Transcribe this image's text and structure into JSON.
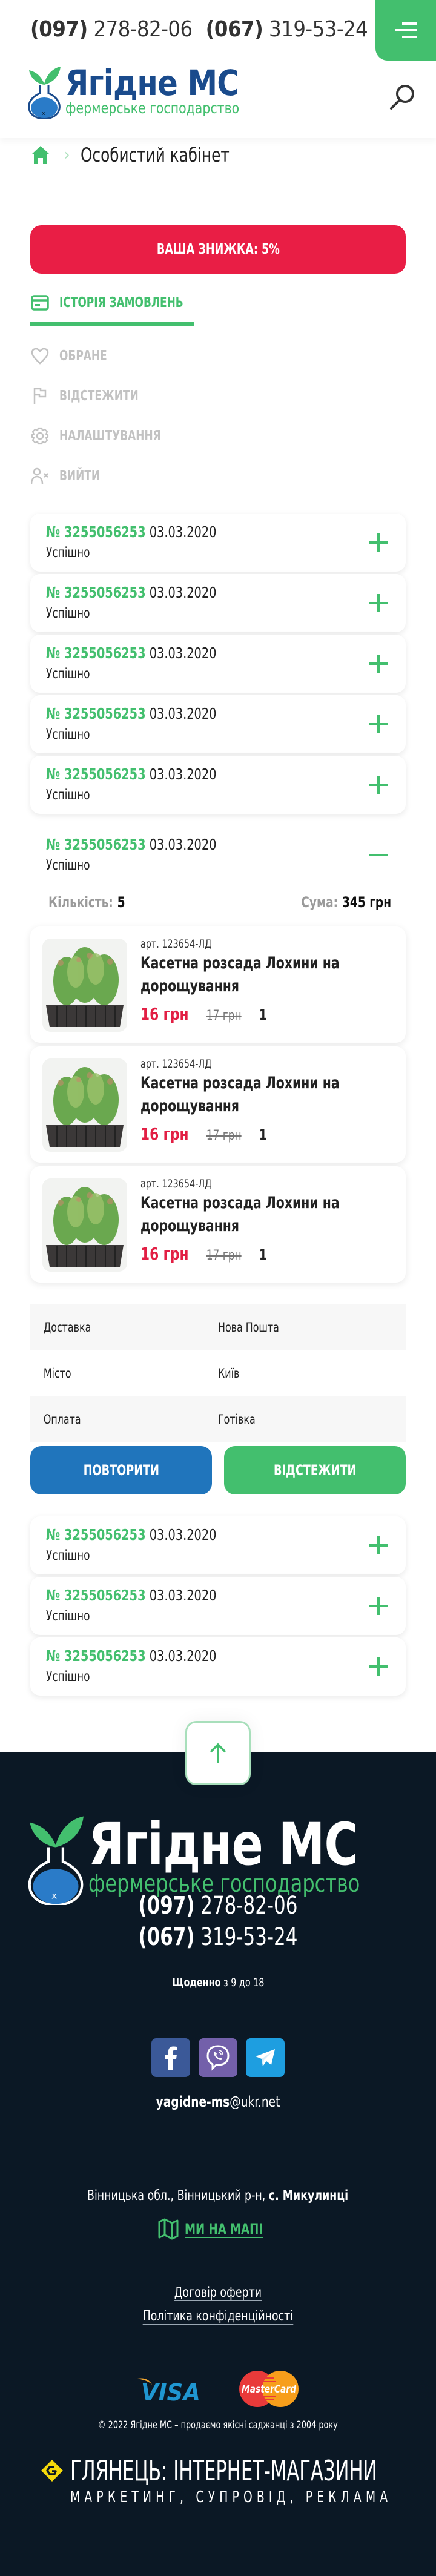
{
  "header": {
    "phones": [
      {
        "code": "(097)",
        "number": "278-82-06"
      },
      {
        "code": "(067)",
        "number": "319-53-24"
      }
    ],
    "menu_icon": "menu-icon",
    "search_icon": "search-icon",
    "logo": {
      "title": "Ягідне МС",
      "subtitle": "фермерське господарство"
    }
  },
  "breadcrumb": {
    "home_icon": "home-icon",
    "current": "Особистий кабінет"
  },
  "discount": {
    "label": "ВАША ЗНИЖКА: 5%"
  },
  "account_nav": {
    "active": {
      "label": "ІСТОРІЯ ЗАМОВЛЕНЬ",
      "icon": "card-icon"
    },
    "items": [
      {
        "label": "ОБРАНЕ",
        "icon": "heart-icon"
      },
      {
        "label": "ВІДСТЕЖИТИ",
        "icon": "flag-icon"
      },
      {
        "label": "НАЛАШТУВАННЯ",
        "icon": "gear-icon"
      },
      {
        "label": "ВИЙТИ",
        "icon": "user-remove-icon"
      }
    ]
  },
  "orders_before": [
    {
      "number": "№ 3255056253",
      "date": "03.03.2020",
      "status": "Успішно"
    },
    {
      "number": "№ 3255056253",
      "date": "03.03.2020",
      "status": "Успішно"
    },
    {
      "number": "№ 3255056253",
      "date": "03.03.2020",
      "status": "Успішно"
    },
    {
      "number": "№ 3255056253",
      "date": "03.03.2020",
      "status": "Успішно"
    },
    {
      "number": "№ 3255056253",
      "date": "03.03.2020",
      "status": "Успішно"
    }
  ],
  "expanded_order": {
    "number": "№ 3255056253",
    "date": "03.03.2020",
    "status": "Успішно",
    "quantity_label": "Кількість:",
    "quantity": "5",
    "sum_label": "Сума:",
    "sum": "345 грн",
    "products": [
      {
        "art": "арт. 123654-ЛД",
        "title": "Касетна розсада Лохини на дорощування",
        "price": "16 грн",
        "old_price": "17 грн",
        "qty": "1"
      },
      {
        "art": "арт. 123654-ЛД",
        "title": "Касетна розсада Лохини на дорощування",
        "price": "16 грн",
        "old_price": "17 грн",
        "qty": "1"
      },
      {
        "art": "арт. 123654-ЛД",
        "title": "Касетна розсада Лохини на дорощування",
        "price": "16 грн",
        "old_price": "17 грн",
        "qty": "1"
      }
    ],
    "details": [
      {
        "key": "Доставка",
        "value": "Нова Пошта"
      },
      {
        "key": "Місто",
        "value": "Київ"
      },
      {
        "key": "Оплата",
        "value": "Готівка"
      }
    ],
    "repeat_label": "ПОВТОРИТИ",
    "track_label": "ВІДСТЕЖИТИ"
  },
  "orders_after": [
    {
      "number": "№ 3255056253",
      "date": "03.03.2020",
      "status": "Успішно"
    },
    {
      "number": "№ 3255056253",
      "date": "03.03.2020",
      "status": "Успішно"
    },
    {
      "number": "№ 3255056253",
      "date": "03.03.2020",
      "status": "Успішно"
    }
  ],
  "footer": {
    "logo": {
      "title": "Ягідне МС",
      "subtitle": "фермерське господарство"
    },
    "phones": [
      {
        "code": "(097)",
        "number": "278-82-06"
      },
      {
        "code": "(067)",
        "number": "319-53-24"
      }
    ],
    "hours_bold": "Щоденно",
    "hours_rest": "з 9 до 18",
    "social": [
      "facebook-icon",
      "viber-icon",
      "telegram-icon"
    ],
    "email_user": "yagidne-ms",
    "email_domain": "@ukr.net",
    "address_regular": "Вінницька обл., Вінницький р-н, ",
    "address_bold": "с. Микулинці",
    "map_label": "МИ НА МАПІ",
    "links": [
      "Договір оферти",
      "Політика конфіденційності"
    ],
    "payments": [
      "VISA",
      "MasterCard"
    ],
    "copyright": "© 2022 Ягідне МС – продаємо якісні саджанці з 2004 року",
    "developer_title": "ГЛЯНЕЦЬ: ІНТЕРНЕТ-МАГАЗИНИ",
    "developer_subtitle": "МАРКЕТИНГ, СУПРОВІД, РЕКЛАМА"
  },
  "colors": {
    "accent_green": "#43bf6e",
    "brand_blue": "#1a4b8c",
    "discount_red": "#e91e45",
    "repeat_blue": "#2075bc",
    "footer_bg": "#0b1825"
  }
}
